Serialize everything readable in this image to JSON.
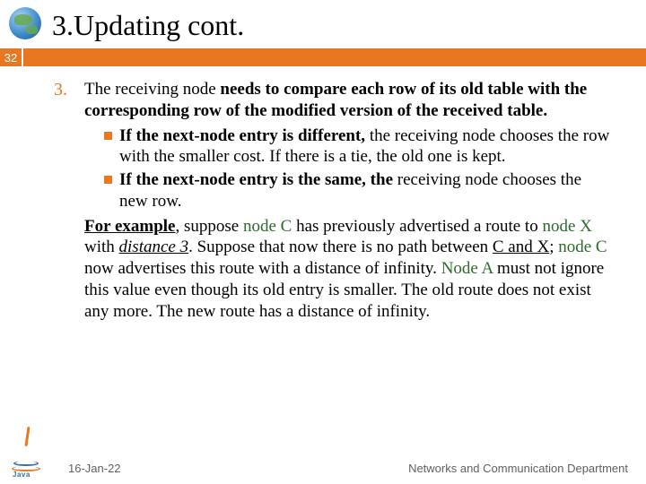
{
  "header": {
    "title": "3.Updating cont."
  },
  "slide_number": "32",
  "content": {
    "item_number": "3.",
    "para1_a": "The receiving node ",
    "para1_b": "needs to compare each row of its old table with the corresponding row of the modified version of the received table.",
    "bullet1_a": "If the next-node entry is different,",
    "bullet1_b": " the receiving node chooses the row with the smaller cost. If there is a tie, the old one is kept.",
    "bullet2_a": "If the next-node entry is the same, the",
    "bullet2_b": " receiving node chooses the new row.",
    "para2_a": "For example",
    "para2_b": ", suppose ",
    "para2_c": "node C",
    "para2_d": " has previously advertised a route to ",
    "para2_e": "node X",
    "para2_f": " with ",
    "para2_g": "distance 3",
    "para2_h": ". Suppose that now there is no path between ",
    "para2_i": "C and X",
    "para2_j": "; ",
    "para2_k": "node C",
    "para2_l": " now advertises this route with a distance of infinity. ",
    "para2_m": "Node A",
    "para2_n": " must not ignore this value even though its old entry is smaller. The old route does not exist any more. The new route has a distance of infinity."
  },
  "footer": {
    "date": "16-Jan-22",
    "dept": "Networks and Communication Department",
    "java": "Java"
  }
}
